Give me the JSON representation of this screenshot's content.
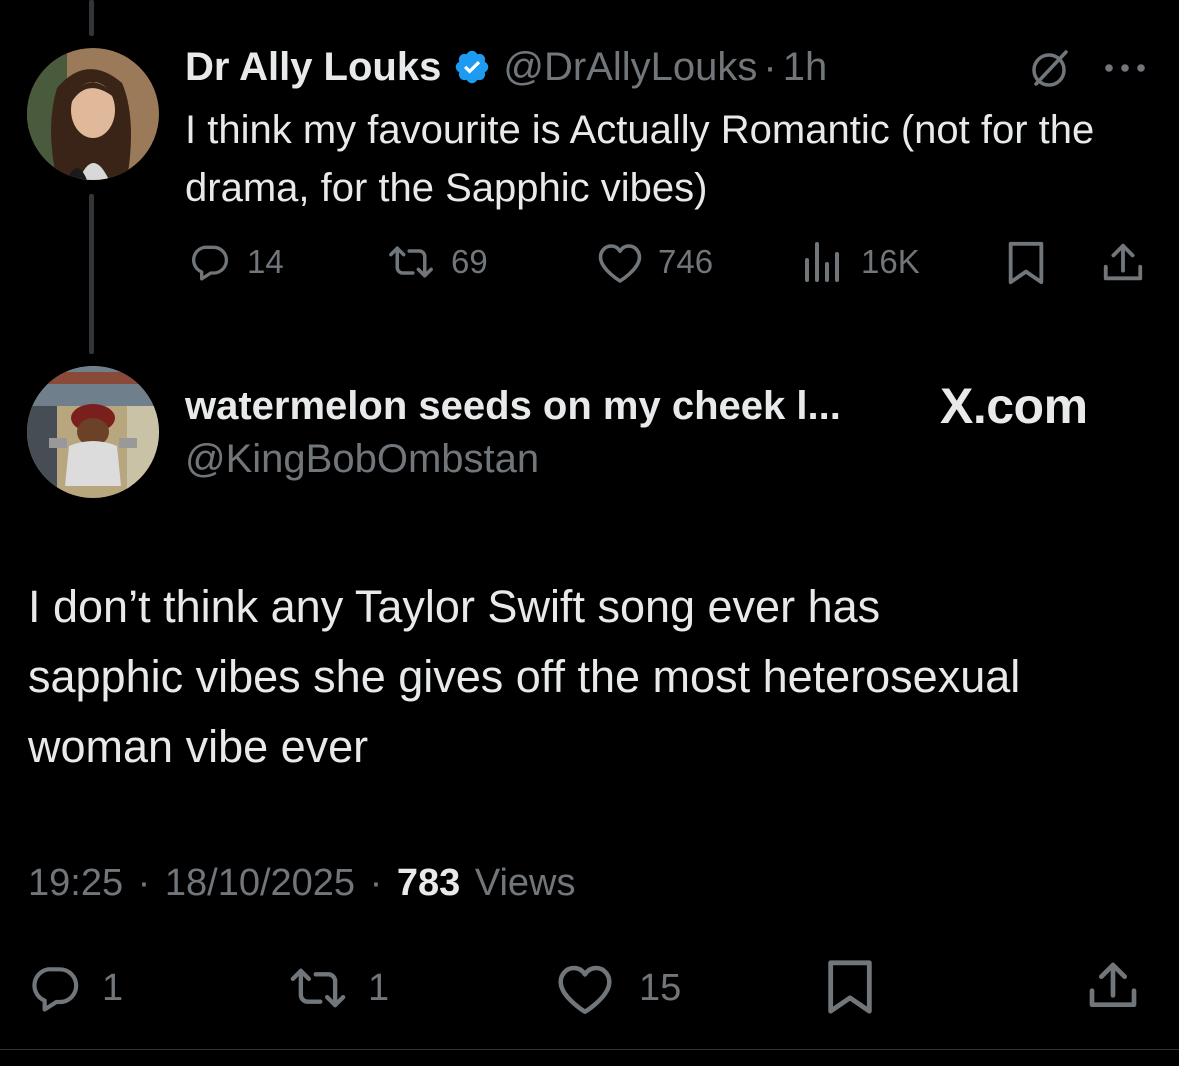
{
  "parent_tweet": {
    "author_name": "Dr Ally Louks",
    "handle": "@DrAllyLouks",
    "separator": "·",
    "time": "1h",
    "text": "I think my favourite is Actually Romantic (not for the drama, for the Sapphic vibes)",
    "actions": {
      "replies": "14",
      "reposts": "69",
      "likes": "746",
      "views": "16K"
    }
  },
  "main_tweet": {
    "author_name": "watermelon seeds on my cheek l...",
    "handle": "@KingBobOmbstan",
    "text": "I don’t think any Taylor Swift song ever has sapphic vibes she gives off the most heterosexual woman vibe ever",
    "time": "19:25",
    "sep1": "·",
    "date": "18/10/2025",
    "sep2": "·",
    "views_count": "783",
    "views_label": "Views",
    "actions": {
      "replies": "1",
      "reposts": "1",
      "likes": "15"
    }
  },
  "watermark": "X.com",
  "colors": {
    "background": "#000000",
    "text": "#e7e9ea",
    "muted": "#71767b",
    "verified": "#1d9bf0"
  },
  "icons": [
    "verified-badge-icon",
    "grok-icon",
    "more-icon",
    "reply-icon",
    "repost-icon",
    "like-icon",
    "views-icon",
    "bookmark-icon",
    "share-icon"
  ]
}
